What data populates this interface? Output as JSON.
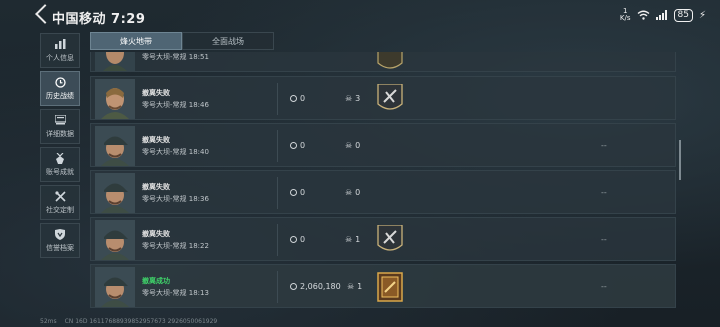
{
  "statusbar": {
    "carrier_time": "中国移动 7:29",
    "net_speed_value": "1",
    "net_speed_unit": "K/s",
    "battery": "85"
  },
  "sidebar": {
    "items": [
      {
        "label": "个人信息",
        "icon": "bar-chart-icon",
        "active": false
      },
      {
        "label": "历史战绩",
        "icon": "history-icon",
        "active": true
      },
      {
        "label": "详细数据",
        "icon": "data-icon",
        "active": false
      },
      {
        "label": "账号成就",
        "icon": "medal-icon",
        "active": false
      },
      {
        "label": "社交定制",
        "icon": "tools-icon",
        "active": false
      },
      {
        "label": "信誉档案",
        "icon": "shield-icon",
        "active": false
      }
    ]
  },
  "tabs": [
    {
      "label": "烽火地带",
      "active": true
    },
    {
      "label": "全面战场",
      "active": false
    }
  ],
  "matches": [
    {
      "result": "",
      "mode": "零号大坝-常规 18:51",
      "money": "",
      "kills": "",
      "badge": "partial",
      "extra": ""
    },
    {
      "result": "撤离失败",
      "mode": "零号大坝-常规 18:46",
      "money": "0",
      "kills": "3",
      "badge": "silver",
      "extra": ""
    },
    {
      "result": "撤离失败",
      "mode": "零号大坝-常规 18:40",
      "money": "0",
      "kills": "0",
      "badge": "none",
      "extra": "--"
    },
    {
      "result": "撤离失败",
      "mode": "零号大坝-常规 18:36",
      "money": "0",
      "kills": "0",
      "badge": "none",
      "extra": "--"
    },
    {
      "result": "撤离失败",
      "mode": "零号大坝-常规 18:22",
      "money": "0",
      "kills": "1",
      "badge": "silver",
      "extra": "--"
    },
    {
      "result": "撤离成功",
      "mode": "零号大坝-常规 18:13",
      "money": "2,060,180",
      "kills": "1",
      "badge": "gold",
      "extra": "--"
    }
  ],
  "footer": {
    "ping": "52ms",
    "id": "CN 16D 16117688939852957673 2926050061929"
  },
  "colors": {
    "success": "#3fd46a",
    "tab_active": "#4f6574"
  }
}
